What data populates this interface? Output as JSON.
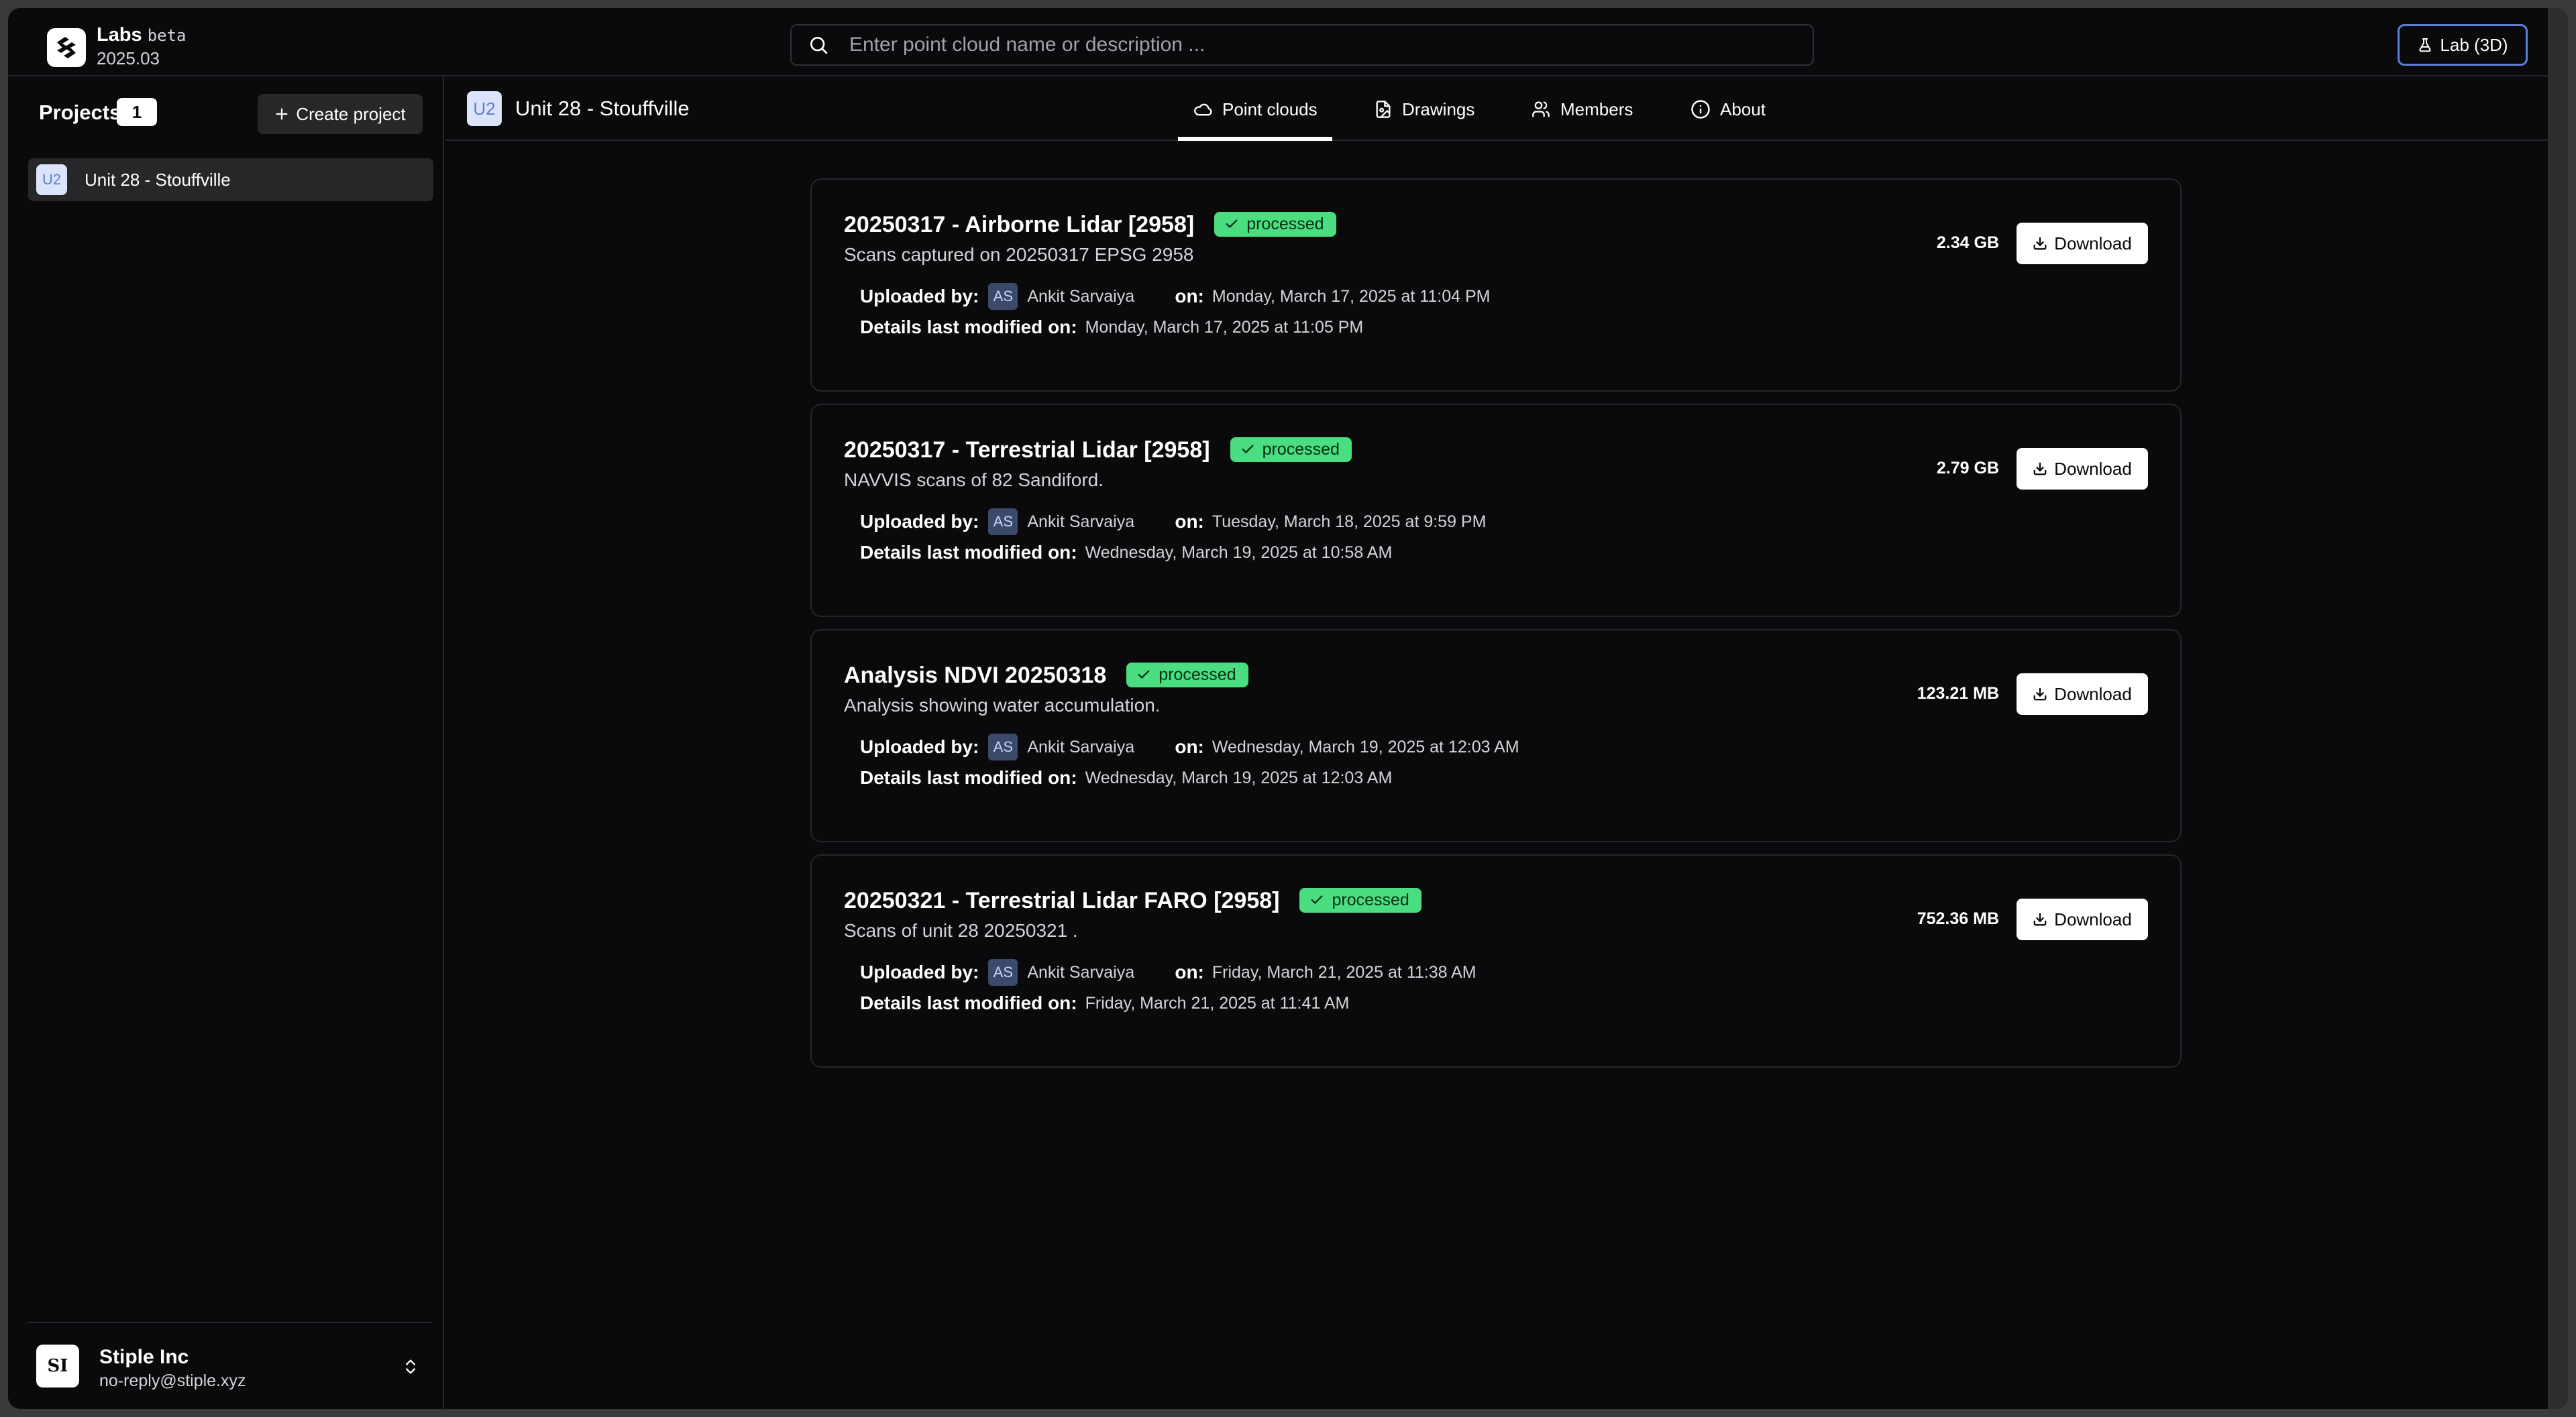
{
  "app": {
    "name": "Labs",
    "beta": "beta",
    "version": "2025.03"
  },
  "search": {
    "placeholder": "Enter point cloud name or description ..."
  },
  "lab_button": "Lab (3D)",
  "sidebar": {
    "title": "Projects",
    "count": "1",
    "create_label": "Create project",
    "projects": [
      {
        "initials": "U2",
        "name": "Unit 28 - Stouffville"
      }
    ],
    "org": {
      "initials": "SI",
      "name": "Stiple Inc",
      "email": "no-reply@stiple.xyz"
    }
  },
  "project": {
    "initials": "U2",
    "name": "Unit 28 - Stouffville",
    "tabs": [
      {
        "label": "Point clouds",
        "icon": "cloud-icon",
        "active": true
      },
      {
        "label": "Drawings",
        "icon": "file-image-icon",
        "active": false
      },
      {
        "label": "Members",
        "icon": "users-icon",
        "active": false
      },
      {
        "label": "About",
        "icon": "info-icon",
        "active": false
      }
    ]
  },
  "labels": {
    "uploaded_by": "Uploaded by:",
    "on": "on:",
    "details_modified": "Details last modified on:",
    "download": "Download"
  },
  "pointclouds": [
    {
      "title": "20250317 - Airborne Lidar [2958]",
      "status": "processed",
      "description": "Scans captured on 20250317 EPSG 2958",
      "uploader_initials": "AS",
      "uploader": "Ankit Sarvaiya",
      "uploaded_on": "Monday, March 17, 2025 at 11:04 PM",
      "modified_on": "Monday, March 17, 2025 at 11:05 PM",
      "size": "2.34 GB"
    },
    {
      "title": "20250317 - Terrestrial Lidar [2958]",
      "status": "processed",
      "description": "NAVVIS scans of 82 Sandiford.",
      "uploader_initials": "AS",
      "uploader": "Ankit Sarvaiya",
      "uploaded_on": "Tuesday, March 18, 2025 at 9:59 PM",
      "modified_on": "Wednesday, March 19, 2025 at 10:58 AM",
      "size": "2.79 GB"
    },
    {
      "title": "Analysis NDVI 20250318",
      "status": "processed",
      "description": "Analysis showing water accumulation.",
      "uploader_initials": "AS",
      "uploader": "Ankit Sarvaiya",
      "uploaded_on": "Wednesday, March 19, 2025 at 12:03 AM",
      "modified_on": "Wednesday, March 19, 2025 at 12:03 AM",
      "size": "123.21 MB"
    },
    {
      "title": "20250321 - Terrestrial Lidar FARO [2958]",
      "status": "processed",
      "description": "Scans of unit 28 20250321 .",
      "uploader_initials": "AS",
      "uploader": "Ankit Sarvaiya",
      "uploaded_on": "Friday, March 21, 2025 at 11:38 AM",
      "modified_on": "Friday, March 21, 2025 at 11:41 AM",
      "size": "752.36 MB"
    }
  ],
  "colors": {
    "background": "#0a0a0c",
    "accent": "#5b7fd4",
    "status_processed": "#4ade80"
  }
}
